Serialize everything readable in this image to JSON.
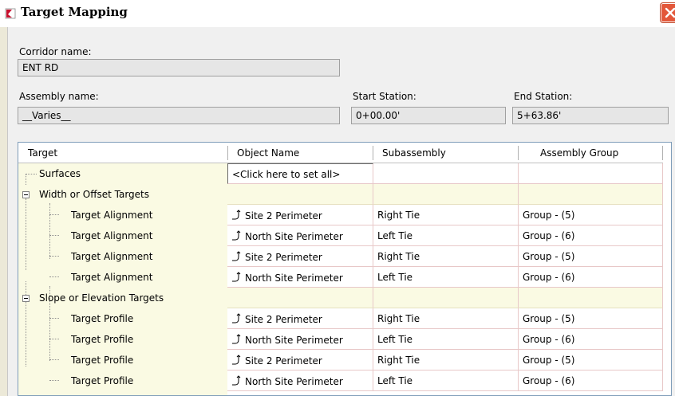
{
  "window": {
    "title": "Target Mapping"
  },
  "corridor": {
    "label": "Corridor name:",
    "value": "ENT RD"
  },
  "assembly": {
    "label": "Assembly name:",
    "value": "__Varies__"
  },
  "start_station": {
    "label": "Start Station:",
    "value": "0+00.00'"
  },
  "end_station": {
    "label": "End Station:",
    "value": "5+63.86'"
  },
  "table": {
    "columns": [
      "Target",
      "Object Name",
      "Subassembly",
      "Assembly Group"
    ],
    "surfaces": {
      "label": "Surfaces",
      "object": "<Click here to set all>"
    },
    "groups": [
      {
        "label": "Width or Offset Targets",
        "rows": [
          {
            "target": "Target Alignment",
            "object": "Site 2 Perimeter",
            "subassembly": "Right Tie",
            "group": "Group - (5)"
          },
          {
            "target": "Target Alignment",
            "object": "North Site Perimeter",
            "subassembly": "Left Tie",
            "group": "Group - (6)"
          },
          {
            "target": "Target Alignment",
            "object": "Site 2 Perimeter",
            "subassembly": "Right Tie",
            "group": "Group - (5)"
          },
          {
            "target": "Target Alignment",
            "object": "North Site Perimeter",
            "subassembly": "Left Tie",
            "group": "Group - (6)"
          }
        ]
      },
      {
        "label": "Slope or Elevation Targets",
        "rows": [
          {
            "target": "Target Profile",
            "object": "Site 2 Perimeter",
            "subassembly": "Right Tie",
            "group": "Group - (5)"
          },
          {
            "target": "Target Profile",
            "object": "North Site Perimeter",
            "subassembly": "Left Tie",
            "group": "Group - (6)"
          },
          {
            "target": "Target Profile",
            "object": "Site 2 Perimeter",
            "subassembly": "Right Tie",
            "group": "Group - (5)"
          },
          {
            "target": "Target Profile",
            "object": "North Site Perimeter",
            "subassembly": "Left Tie",
            "group": "Group - (6)"
          }
        ]
      }
    ]
  }
}
